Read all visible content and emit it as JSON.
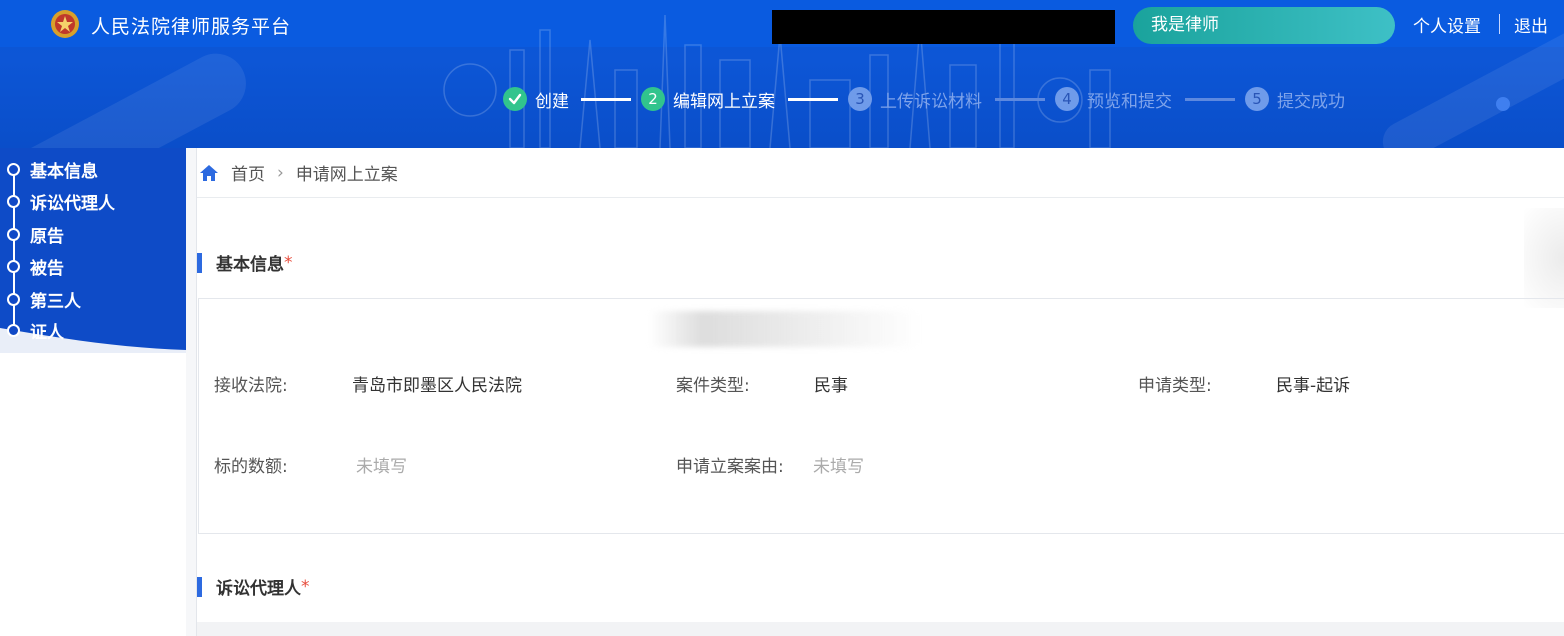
{
  "header": {
    "app_title": "人民法院律师服务平台",
    "role_button": "我是律师",
    "settings_link": "个人设置",
    "logout_link": "退出"
  },
  "steps": [
    {
      "num": "",
      "label": "创建",
      "state": "done"
    },
    {
      "num": "2",
      "label": "编辑网上立案",
      "state": "active"
    },
    {
      "num": "3",
      "label": "上传诉讼材料",
      "state": "pending"
    },
    {
      "num": "4",
      "label": "预览和提交",
      "state": "pending"
    },
    {
      "num": "5",
      "label": "提交成功",
      "state": "pending"
    }
  ],
  "sidebar": {
    "items": [
      {
        "label": "基本信息"
      },
      {
        "label": "诉讼代理人"
      },
      {
        "label": "原告"
      },
      {
        "label": "被告"
      },
      {
        "label": "第三人"
      },
      {
        "label": "证人"
      }
    ]
  },
  "breadcrumb": {
    "home": "首页",
    "current": "申请网上立案"
  },
  "basic_info": {
    "title": "基本信息",
    "required_mark": "*",
    "fields": {
      "court_label": "接收法院:",
      "court_value": "青岛市即墨区人民法院",
      "case_type_label": "案件类型:",
      "case_type_value": "民事",
      "apply_type_label": "申请类型:",
      "apply_type_value": "民事-起诉",
      "amount_label": "标的数额:",
      "amount_value": "未填写",
      "cause_label": "申请立案案由:",
      "cause_value": "未填写"
    }
  },
  "agent_section": {
    "title": "诉讼代理人",
    "required_mark": "*"
  },
  "colors": {
    "header_blue": "#0a57d8",
    "step_done": "#31c48d",
    "role_button": "#2bb3b1",
    "accent_bar": "#2d6ae0",
    "required": "#e74c3c"
  }
}
